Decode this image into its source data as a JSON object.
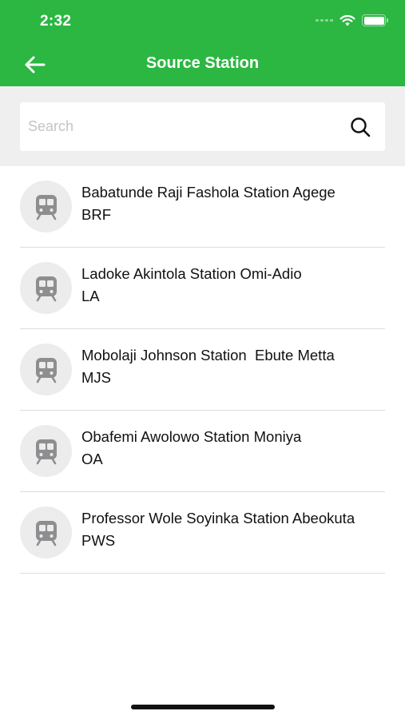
{
  "status_bar": {
    "time": "2:32"
  },
  "header": {
    "title": "Source Station"
  },
  "search": {
    "placeholder": "Search"
  },
  "stations": [
    {
      "name": "Babatunde Raji Fashola Station Agege",
      "code": "BRF"
    },
    {
      "name": "Ladoke Akintola Station Omi-Adio",
      "code": "LA"
    },
    {
      "name": "Mobolaji Johnson Station  Ebute Metta",
      "code": "MJS"
    },
    {
      "name": "Obafemi Awolowo Station Moniya",
      "code": "OA"
    },
    {
      "name": "Professor Wole Soyinka Station Abeokuta",
      "code": "PWS"
    }
  ],
  "colors": {
    "accent": "#2bb742",
    "search_bg": "#efefef",
    "icon_gray": "#8e8e90"
  },
  "icons": {
    "back": "arrow-left-icon",
    "search": "search-icon",
    "station": "train-icon"
  }
}
